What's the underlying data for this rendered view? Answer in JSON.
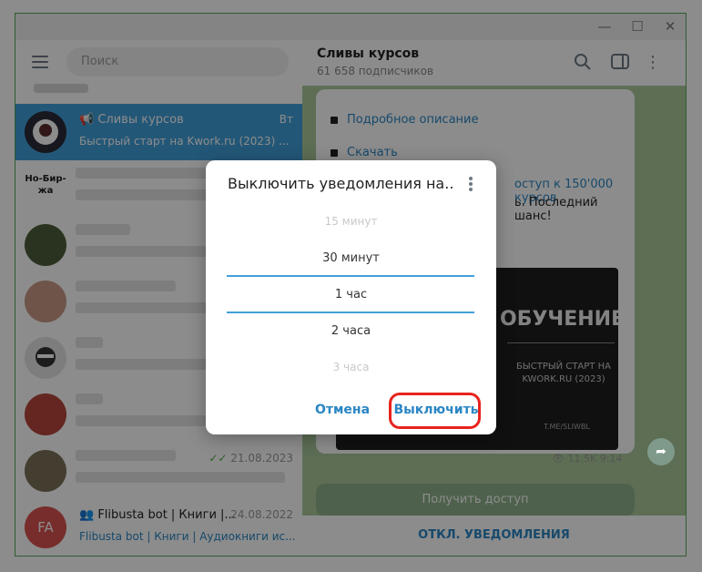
{
  "window": {
    "minimize": "—",
    "maximize": "☐",
    "close": "✕"
  },
  "sidebar": {
    "search_placeholder": "Поиск",
    "chats": [
      {
        "title": "Сливы курсов",
        "subtitle": "Быстрый старт на Kwork.ru (2023) ...",
        "date": "Вт",
        "active": true
      },
      {
        "avatar_text": "Но-Бир-жа"
      },
      {},
      {},
      {},
      {},
      {
        "date": "21.08.2023"
      },
      {
        "title": "Flibusta bot | Книги |...",
        "subtitle": "Flibusta bot | Книги | Аудиокниги ис...",
        "date": "24.08.2022",
        "avatar_text": "FA"
      }
    ]
  },
  "channel": {
    "name": "Сливы курсов",
    "subscribers": "61 658 подписчиков",
    "links": [
      "Подробное описание",
      "Скачать"
    ],
    "text_fragment_1": "оступ к 150'000 курсов",
    "text_fragment_2": "ь. Последний шанс!",
    "promo": {
      "title": "ОБУЧЕНИЕ",
      "subtitle": "БЫСТРЫЙ СТАРТ НА KWORK.RU (2023)",
      "url": "T.ME/SLIWBL"
    },
    "views": "11.5K",
    "time": "9:14",
    "get_access": "Получить доступ",
    "bottom_action": "ОТКЛ. УВЕДОМЛЕНИЯ"
  },
  "dialog": {
    "title": "Выключить уведомления на...",
    "options": [
      "15 минут",
      "30 минут",
      "1 час",
      "2 часа",
      "3 часа"
    ],
    "selected": "1 час",
    "cancel": "Отмена",
    "confirm": "Выключить"
  },
  "colors": {
    "accent": "#419fd9",
    "highlight": "#e8231d",
    "chat_bg": "#a9c99b"
  }
}
